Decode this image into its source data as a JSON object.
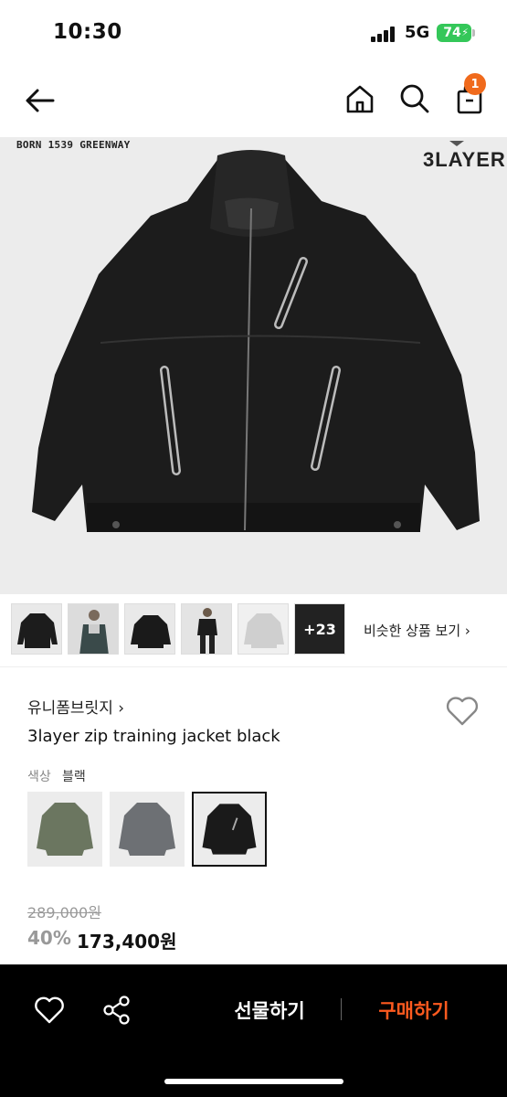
{
  "status": {
    "time": "10:30",
    "network": "5G",
    "battery": "74"
  },
  "nav": {
    "icons": [
      "back-arrow-icon",
      "home-icon",
      "search-icon",
      "shopping-bag-icon"
    ],
    "cart_badge": "1"
  },
  "hero": {
    "caption": "BORN 1539 GREENWAY",
    "brand_logo": "3LAYER"
  },
  "thumbnails": {
    "more_count": "+23",
    "similar_link": "비슷한 상품 보기 ›"
  },
  "product": {
    "store_name": "유니폼브릿지 ›",
    "title": "3layer zip training jacket black",
    "color_label": "색상",
    "color_value": "블랙",
    "swatches": [
      "olive-green",
      "gray",
      "black"
    ],
    "original_price": "289,000원",
    "discount": "40%",
    "sale_price": "173,400원"
  },
  "bottom_bar": {
    "gift_label": "선물하기",
    "buy_label": "구매하기"
  },
  "colors": {
    "accent": "#ff5a1f",
    "badge": "#f06a1c",
    "battery": "#34c759"
  }
}
